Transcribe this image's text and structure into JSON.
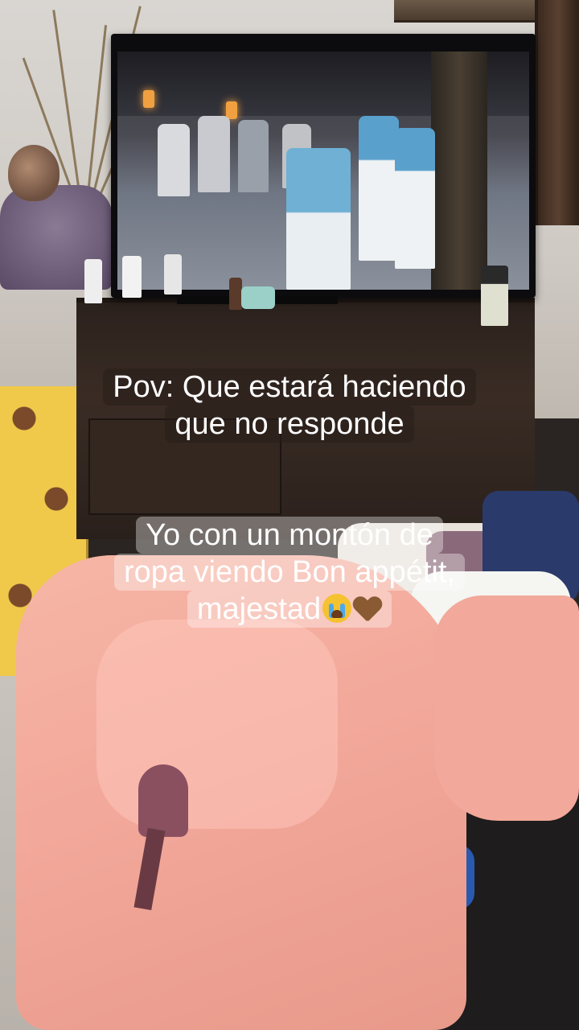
{
  "overlay": {
    "top_caption": {
      "line1": "Pov: Que estará haciendo",
      "line2": "que no responde"
    },
    "bottom_caption": {
      "line1": "Yo con un montón de",
      "line2": "ropa viendo Bon appétit,",
      "line3": "majestad",
      "emojis": [
        "loudly-crying-face-icon",
        "brown-heart-icon"
      ]
    }
  },
  "colors": {
    "caption_text": "#ffffff",
    "pink_clothes": "#f2a89a",
    "curtain_yellow": "#f0c94a",
    "dresser": "#2b211c"
  }
}
